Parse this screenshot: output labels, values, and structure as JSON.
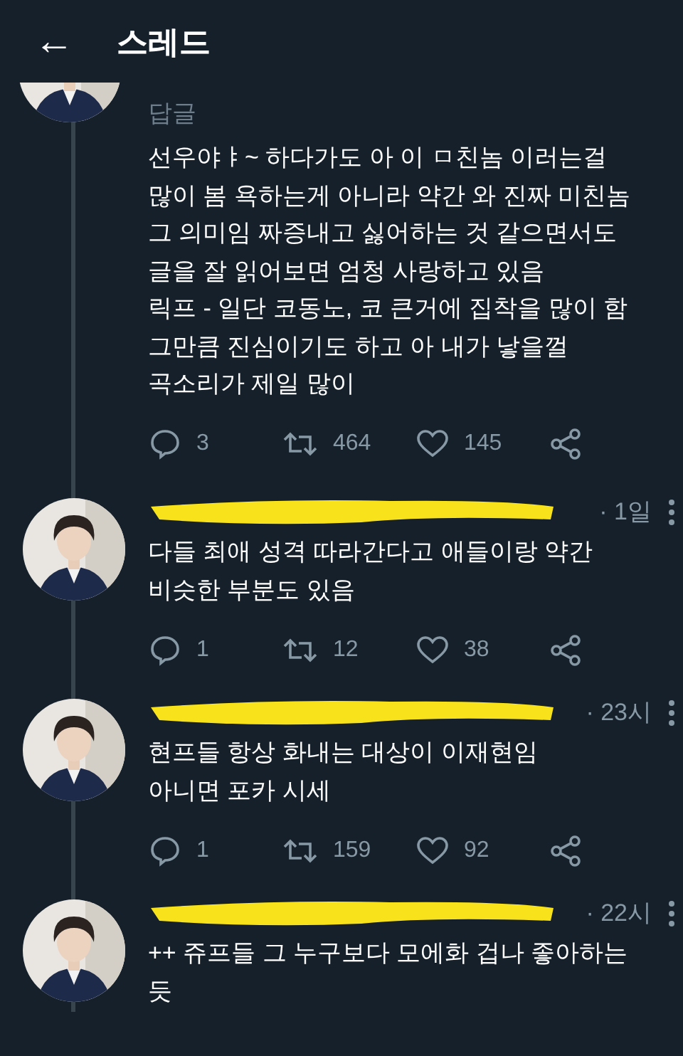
{
  "header": {
    "back_icon": "←",
    "title": "스레드"
  },
  "first_tweet": {
    "reply_label": "답글",
    "text": "선우야ㅑ~ 하다가도 아 이 ㅁ친놈 이러는걸\n많이 봄 욕하는게 아니라 약간 와 진짜 미친놈\n그 의미임 짜증내고 싫어하는 것 같으면서도\n글을 잘 읽어보면 엄청 사랑하고 있음\n릭프 - 일단 코동노, 코 큰거에 집착을 많이 함\n그만큼 진심이기도 하고 아 내가 낳을껄\n곡소리가 제일 많이",
    "replies": "3",
    "retweets": "464",
    "likes": "145"
  },
  "replies": [
    {
      "time": "· 1일",
      "text": "다들 최애 성격 따라간다고 애들이랑 약간\n비슷한 부분도 있음",
      "replies": "1",
      "retweets": "12",
      "likes": "38"
    },
    {
      "time": "· 23시",
      "text": "현프들 항상 화내는 대상이 이재현임\n아니면 포카 시세",
      "replies": "1",
      "retweets": "159",
      "likes": "92"
    },
    {
      "time": "· 22시",
      "text": "++ 쥬프들 그 누구보다 모에화 겁나 좋아하는\n듯"
    }
  ]
}
